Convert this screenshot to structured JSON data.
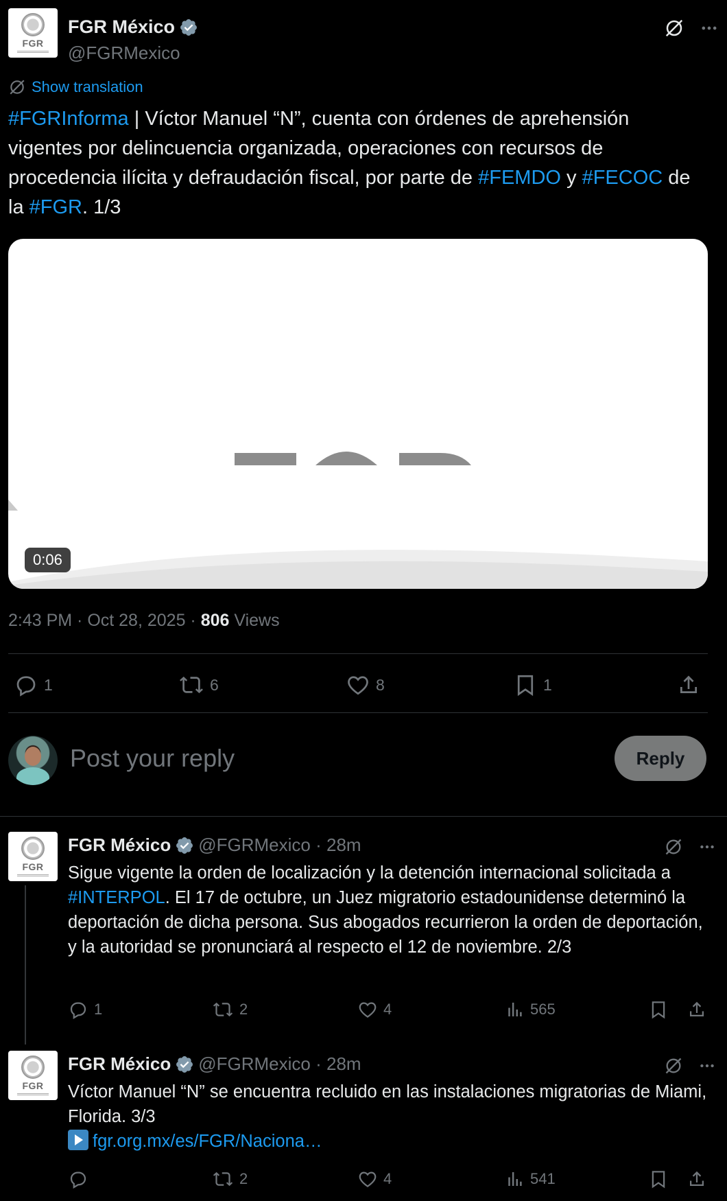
{
  "main_tweet": {
    "author_name": "FGR México",
    "author_handle": "@FGRMexico",
    "avatar_text": "FGR",
    "show_translation": "Show translation",
    "text_parts": {
      "tag1": "#FGRInforma",
      "t1": " | Víctor Manuel “N”, cuenta con órdenes de aprehensión vigentes por delincuencia organizada, operaciones con recursos de procedencia ilícita y defraudación fiscal, por parte de ",
      "tag2": "#FEMDO",
      "t2": " y ",
      "tag3": "#FECOC",
      "t3": " de la ",
      "tag4": "#FGR",
      "t4": ". 1/3"
    },
    "video_duration": "0:06",
    "time": "2:43 PM · Oct 28, 2025 · ",
    "views_count": "806",
    "views_label": " Views",
    "actions": {
      "replies": "1",
      "reposts": "6",
      "likes": "8",
      "bookmarks": "1"
    }
  },
  "composer": {
    "placeholder": "Post your reply",
    "reply_button": "Reply"
  },
  "thread": [
    {
      "author_name": "FGR México",
      "author_handle": "@FGRMexico · 28m",
      "text_parts": {
        "t1": "Sigue vigente la orden de localización y la detención internacional solicitada a ",
        "tag1": "#INTERPOL",
        "t2": ". El 17 de octubre, un Juez migratorio estadounidense determinó la deportación de dicha persona. Sus abogados recurrieron la orden de deportación, y la autoridad se pronunciará al respecto el 12 de noviembre. 2/3"
      },
      "actions": {
        "replies": "1",
        "reposts": "2",
        "likes": "4",
        "views": "565"
      }
    },
    {
      "author_name": "FGR México",
      "author_handle": "@FGRMexico · 28m",
      "text": "Víctor Manuel “N” se encuentra recluido en las instalaciones migratorias de Miami, Florida. 3/3",
      "link": "fgr.org.mx/es/FGR/Naciona…",
      "actions": {
        "replies": "",
        "reposts": "2",
        "likes": "4",
        "views": "541"
      }
    }
  ],
  "colors": {
    "background": "#000000",
    "link": "#1d9bf0",
    "muted": "#71767b",
    "text": "#e7e9ea",
    "divider": "#2f3336"
  },
  "icons": [
    "verified-badge-icon",
    "grok-icon",
    "more-icon",
    "translate-icon",
    "reply-icon",
    "repost-icon",
    "like-icon",
    "bookmark-icon",
    "share-icon",
    "views-icon",
    "play-button-emoji"
  ]
}
